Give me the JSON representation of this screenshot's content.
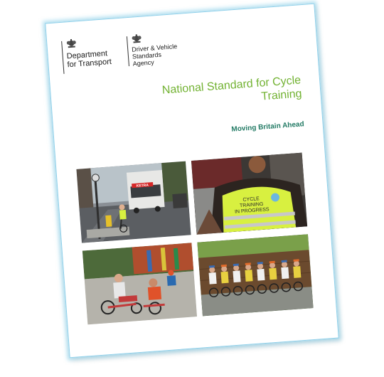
{
  "logos": {
    "dft": {
      "line1": "Department",
      "line2": "for Transport"
    },
    "dvsa": {
      "line1": "Driver & Vehicle",
      "line2": "Standards",
      "line3": "Agency"
    }
  },
  "title": {
    "line1": "National Standard for Cycle",
    "line2": "Training"
  },
  "tagline": "Moving Britain Ahead",
  "photos": {
    "truck_sign": "KETRA",
    "vest_line1": "CYCLE",
    "vest_line2": "TRAINING",
    "vest_line3": "IN PROGRESS"
  },
  "colors": {
    "title_green": "#72b232",
    "tagline_teal": "#227a64",
    "vest_yellow": "#d8f040",
    "border_glow": "#8fd0ea"
  }
}
